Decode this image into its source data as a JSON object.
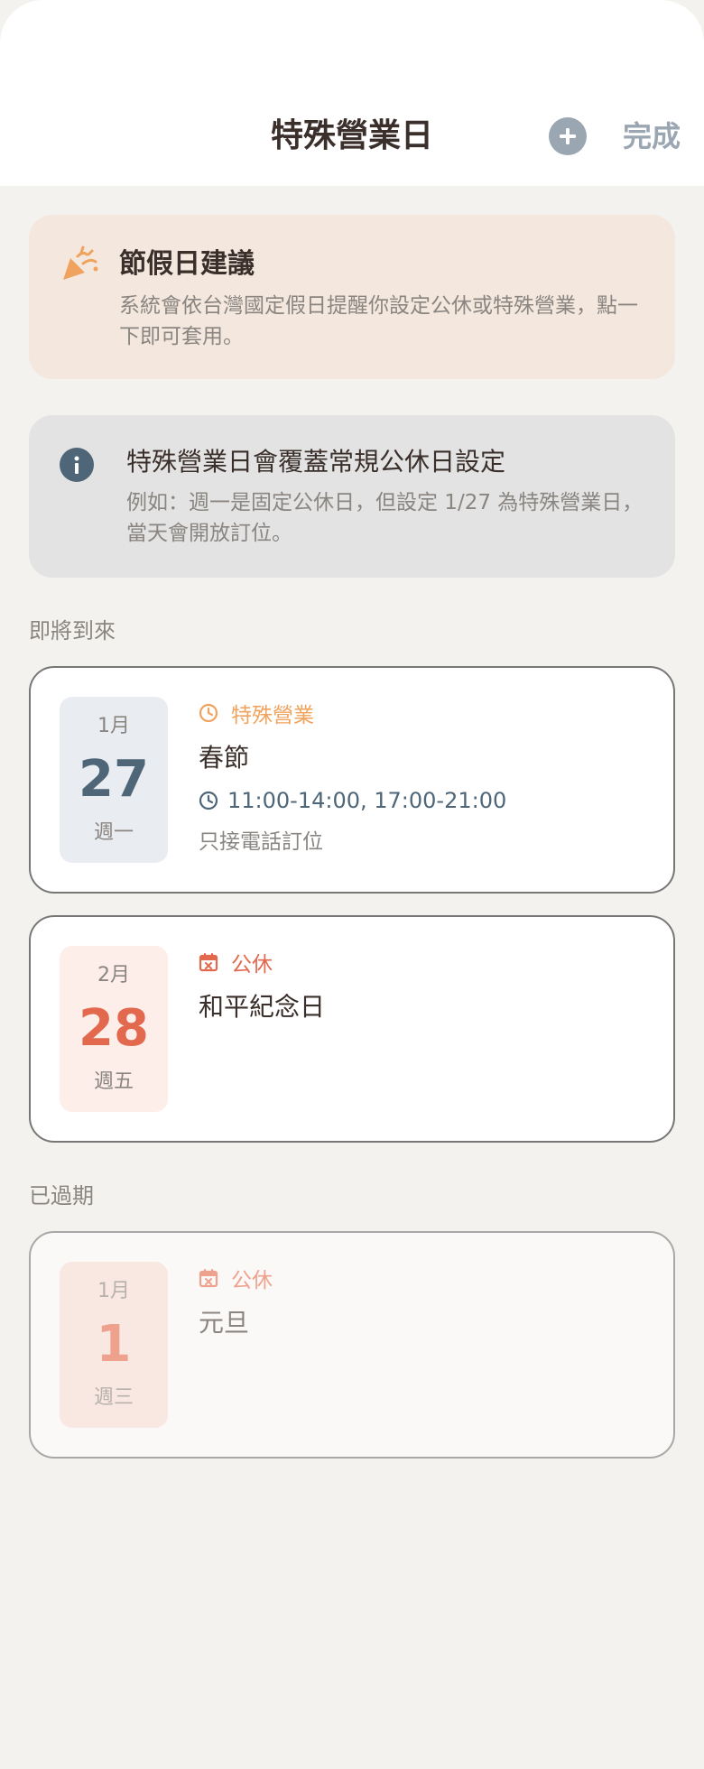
{
  "header": {
    "title": "特殊營業日",
    "add_icon": "plus-circle-icon",
    "done_label": "完成"
  },
  "holiday_tip": {
    "icon": "party-popper-icon",
    "title": "節假日建議",
    "description": "系統會依台灣國定假日提醒你設定公休或特殊營業，點一下即可套用。"
  },
  "info_notice": {
    "icon": "info-icon",
    "title": "特殊營業日會覆蓋常規公休日設定",
    "description": "例如：週一是固定公休日，但設定 1/27 為特殊營業日，當天會開放訂位。"
  },
  "upcoming": {
    "label": "即將到來",
    "events": [
      {
        "month": "1月",
        "day": "27",
        "weekday": "週一",
        "type": "特殊營業",
        "type_icon": "clock-icon",
        "name": "春節",
        "hours": "11:00-14:00, 17:00-21:00",
        "note": "只接電話訂位"
      },
      {
        "month": "2月",
        "day": "28",
        "weekday": "週五",
        "type": "公休",
        "type_icon": "calendar-x-icon",
        "name": "和平紀念日"
      }
    ]
  },
  "past": {
    "label": "已過期",
    "events": [
      {
        "month": "1月",
        "day": "1",
        "weekday": "週三",
        "type": "公休",
        "type_icon": "calendar-x-icon",
        "name": "元旦"
      }
    ]
  },
  "colors": {
    "special_accent": "#f0a35e",
    "closed_accent": "#e2684e",
    "info_blue": "#4e6678",
    "muted_gray": "#9aa6b2"
  }
}
